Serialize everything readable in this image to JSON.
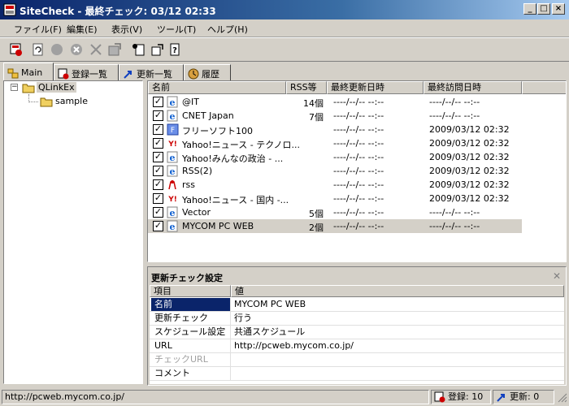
{
  "window": {
    "title": "SiteCheck - 最終チェック: 03/12 02:33"
  },
  "menu": [
    "ファイル(F)",
    "編集(E)",
    "表示(V)",
    "ツール(T)",
    "ヘルプ(H)"
  ],
  "tabs": [
    "Main",
    "登録一覧",
    "更新一覧",
    "履歴"
  ],
  "tree": {
    "root": "QLinkEx",
    "child": "sample"
  },
  "list": {
    "columns": [
      "名前",
      "RSS等",
      "最終更新日時",
      "最終訪問日時"
    ],
    "rows": [
      {
        "name": "@IT",
        "rss": "14個",
        "updated": "----/--/-- --:--",
        "visited": "----/--/-- --:--",
        "icon": "ie-icon"
      },
      {
        "name": "CNET Japan",
        "rss": "7個",
        "updated": "----/--/-- --:--",
        "visited": "----/--/-- --:--",
        "icon": "ie-icon"
      },
      {
        "name": "フリーソフト100",
        "rss": "",
        "updated": "----/--/-- --:--",
        "visited": "2009/03/12 02:32",
        "icon": "freesoft-icon"
      },
      {
        "name": "Yahoo!ニュース - テクノロ...",
        "rss": "",
        "updated": "----/--/-- --:--",
        "visited": "2009/03/12 02:32",
        "icon": "yahoo-icon"
      },
      {
        "name": "Yahoo!みんなの政治 - ...",
        "rss": "",
        "updated": "----/--/-- --:--",
        "visited": "2009/03/12 02:32",
        "icon": "ie-icon"
      },
      {
        "name": "RSS(2)",
        "rss": "",
        "updated": "----/--/-- --:--",
        "visited": "2009/03/12 02:32",
        "icon": "ie-icon"
      },
      {
        "name": "rss",
        "rss": "",
        "updated": "----/--/-- --:--",
        "visited": "2009/03/12 02:32",
        "icon": "rss-red-icon"
      },
      {
        "name": "Yahoo!ニュース - 国内 -...",
        "rss": "",
        "updated": "----/--/-- --:--",
        "visited": "2009/03/12 02:32",
        "icon": "yahoo-icon"
      },
      {
        "name": "Vector",
        "rss": "5個",
        "updated": "----/--/-- --:--",
        "visited": "----/--/-- --:--",
        "icon": "ie-icon"
      },
      {
        "name": "MYCOM PC WEB",
        "rss": "2個",
        "updated": "----/--/-- --:--",
        "visited": "----/--/-- --:--",
        "icon": "ie-icon",
        "selected": true
      }
    ]
  },
  "settings": {
    "title": "更新チェック設定",
    "headers": [
      "項目",
      "値"
    ],
    "rows": [
      {
        "key": "名前",
        "value": "MYCOM PC WEB",
        "selected": true
      },
      {
        "key": "更新チェック",
        "value": "行う"
      },
      {
        "key": "スケジュール設定",
        "value": "共通スケジュール"
      },
      {
        "key": "URL",
        "value": "http://pcweb.mycom.co.jp/"
      },
      {
        "key": "チェックURL",
        "value": "",
        "disabled": true
      },
      {
        "key": "コメント",
        "value": ""
      }
    ]
  },
  "status": {
    "url": "http://pcweb.mycom.co.jp/",
    "registered": "登録: 10",
    "updated": "更新: 0"
  },
  "colors": {
    "titlebar": "#0a246a",
    "selection": "#0a246a",
    "face": "#d4d0c8"
  }
}
